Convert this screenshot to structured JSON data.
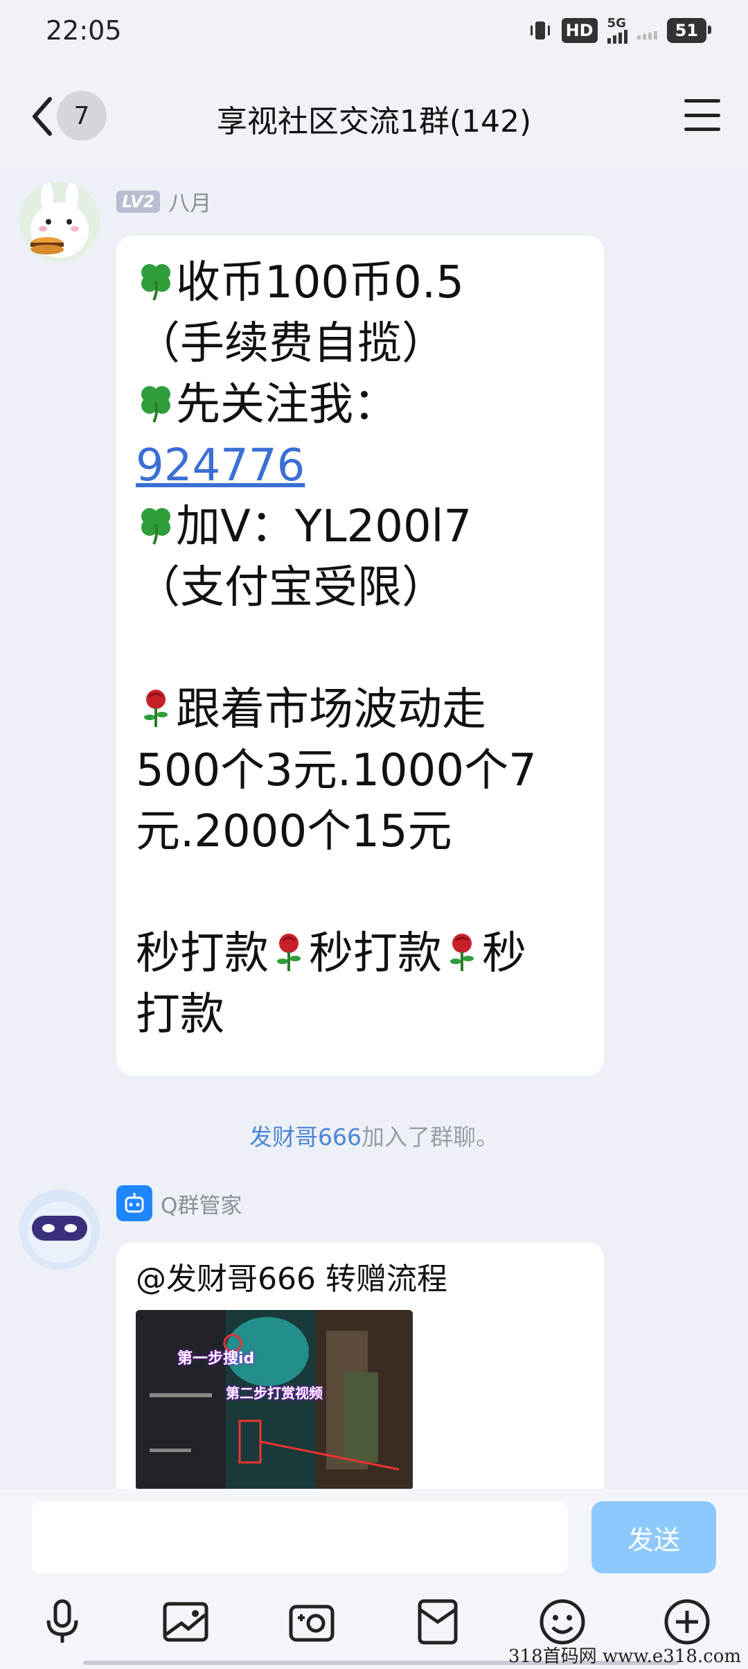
{
  "status_bar": {
    "time": "22:05",
    "hd_label": "HD",
    "net_label": "5G",
    "battery": "51"
  },
  "header": {
    "back_count": "7",
    "title": "享视社区交流1群(142)"
  },
  "messages": {
    "first": {
      "sender_level": "LV2",
      "sender_name": "八月",
      "line1": "收币100币0.5",
      "line2": "（手续费自揽）",
      "line3": "先关注我：",
      "line4": "924776",
      "line5": "加V：YL200l7",
      "line6": "（支付宝受限）",
      "line7": "跟着市场波动走",
      "line8": "500个3元.1000个7",
      "line9": "元.2000个15元",
      "line10_a": "秒打款",
      "line10_b": "秒打款",
      "line10_c": "秒",
      "line11": "打款"
    },
    "system": {
      "name": "发财哥666",
      "text": "加入了群聊。"
    },
    "bot": {
      "sender_name": "Q群管家",
      "text": "@发财哥666 转赠流程",
      "image_caption_1": "第一步搜id",
      "image_caption_2": "第二步打赏视频"
    }
  },
  "input_bar": {
    "send_label": "发送"
  },
  "watermark": "318首码网  www.e318.com",
  "colors": {
    "accent": "#3b6fd4",
    "send_button": "#8ec9fd",
    "background": "#eef0f7"
  }
}
